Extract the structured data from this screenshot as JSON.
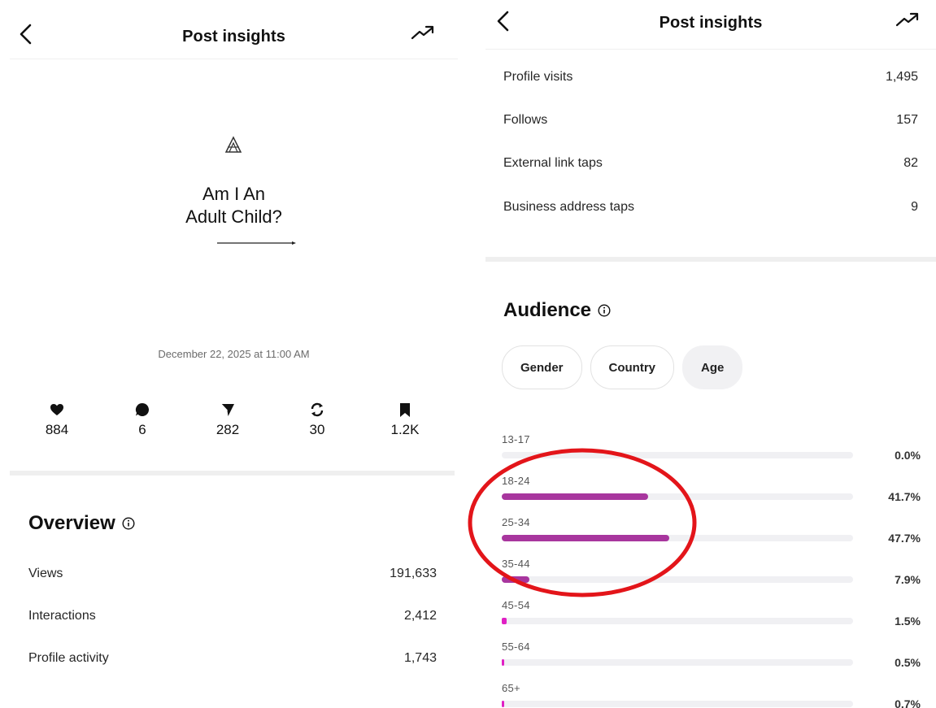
{
  "left": {
    "header": {
      "title": "Post insights"
    },
    "post": {
      "text_line1": "Am I An",
      "text_line2": "Adult Child?"
    },
    "date": "December 22, 2025 at 11:00 AM",
    "stats": [
      {
        "icon": "heart-icon",
        "value": "884"
      },
      {
        "icon": "comment-icon",
        "value": "6"
      },
      {
        "icon": "send-icon",
        "value": "282"
      },
      {
        "icon": "repost-icon",
        "value": "30"
      },
      {
        "icon": "bookmark-icon",
        "value": "1.2K"
      }
    ],
    "overview": {
      "title": "Overview",
      "rows": [
        {
          "label": "Views",
          "value": "191,633"
        },
        {
          "label": "Interactions",
          "value": "2,412"
        },
        {
          "label": "Profile activity",
          "value": "1,743"
        }
      ]
    }
  },
  "right": {
    "header": {
      "title": "Post insights"
    },
    "activity_rows": [
      {
        "label": "Profile visits",
        "value": "1,495"
      },
      {
        "label": "Follows",
        "value": "157"
      },
      {
        "label": "External link taps",
        "value": "82"
      },
      {
        "label": "Business address taps",
        "value": "9"
      }
    ],
    "audience": {
      "title": "Audience",
      "tabs": [
        {
          "label": "Gender",
          "active": false
        },
        {
          "label": "Country",
          "active": false
        },
        {
          "label": "Age",
          "active": true
        }
      ],
      "age_groups": [
        {
          "label": "13-17",
          "percent": 0.0,
          "display": "0.0%"
        },
        {
          "label": "18-24",
          "percent": 41.7,
          "display": "41.7%"
        },
        {
          "label": "25-34",
          "percent": 47.7,
          "display": "47.7%"
        },
        {
          "label": "35-44",
          "percent": 7.9,
          "display": "7.9%"
        },
        {
          "label": "45-54",
          "percent": 1.5,
          "display": "1.5%"
        },
        {
          "label": "55-64",
          "percent": 0.5,
          "display": "0.5%"
        },
        {
          "label": "65+",
          "percent": 0.7,
          "display": "0.7%"
        }
      ]
    }
  },
  "colors": {
    "bar_fill": "#a8369e",
    "bar_fill_small": "#e020c4",
    "bar_track": "#f0f0f3",
    "annotation": "#e3151a"
  }
}
